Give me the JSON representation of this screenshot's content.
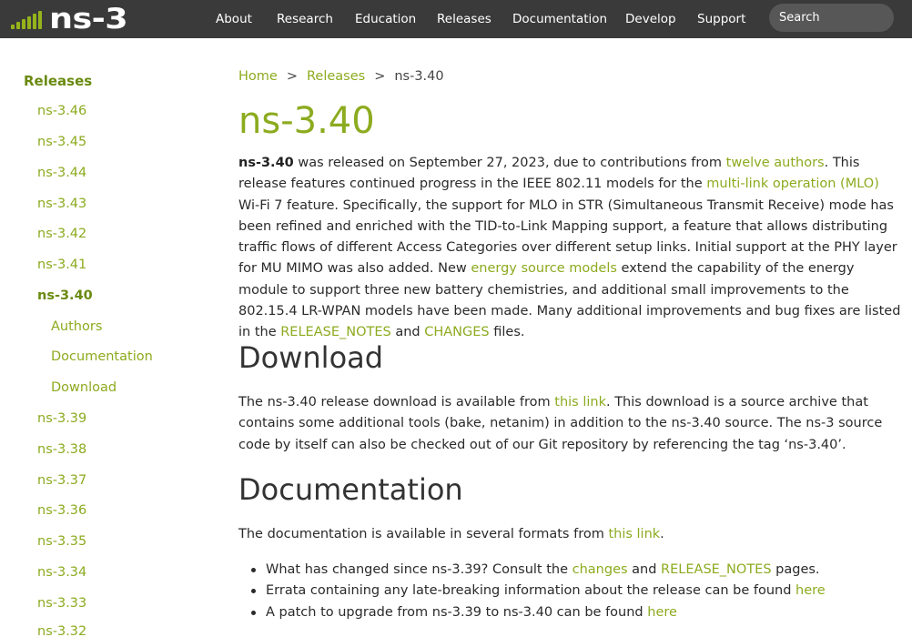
{
  "brand": {
    "logo_text": "ns-3"
  },
  "nav": {
    "items": [
      "About",
      "Research",
      "Education",
      "Releases",
      "Documentation",
      "Develop",
      "Support"
    ],
    "search_placeholder": "Search"
  },
  "sidebar": {
    "heading": "Releases",
    "before": [
      "ns-3.46",
      "ns-3.45",
      "ns-3.44",
      "ns-3.43",
      "ns-3.42",
      "ns-3.41"
    ],
    "active": "ns-3.40",
    "sub": [
      "Authors",
      "Documentation",
      "Download"
    ],
    "after": [
      "ns-3.39",
      "ns-3.38",
      "ns-3.37",
      "ns-3.36",
      "ns-3.35",
      "ns-3.34",
      "ns-3.33",
      "ns-3.32"
    ]
  },
  "breadcrumb": {
    "home": "Home",
    "sep": ">",
    "releases": "Releases",
    "current": "ns-3.40"
  },
  "title": "ns-3.40",
  "intro": {
    "strong": "ns-3.40",
    "t1": " was released on September 27, 2023, due to contributions from ",
    "link_authors": "twelve authors",
    "t2": ". This release features continued progress in the IEEE 802.11 models for the ",
    "link_mlo": "multi-link operation (MLO)",
    "t3": " Wi-Fi 7 feature. Specifically, the support for MLO in STR (Simultaneous Transmit Receive) mode has been refined and enriched with the TID-to-Link Mapping support, a feature that allows distributing traffic flows of different Access Categories over different setup links. Initial support at the PHY layer for MU MIMO was also added. New ",
    "link_energy": "energy source models",
    "t4": " extend the capability of the energy module to support three new battery chemistries, and additional small improvements to the 802.15.4 LR-WPAN models have been made. Many additional improvements and bug fixes are listed in the ",
    "link_release_notes": "RELEASE_NOTES",
    "t5": " and ",
    "link_changes": "CHANGES",
    "t6": " files."
  },
  "download": {
    "heading": "Download",
    "t1": "The ns-3.40 release download is available from ",
    "link": "this link",
    "t2": ". This download is a source archive that contains some additional tools (bake, netanim) in addition to the ns-3.40 source. The ns-3 source code by itself can also be checked out of our Git repository by referencing the tag ‘ns-3.40’."
  },
  "documentation": {
    "heading": "Documentation",
    "t1": "The documentation is available in several formats from ",
    "link": "this link",
    "t2": ".",
    "bullets": [
      {
        "a": "What has changed since ns-3.39? Consult the ",
        "l1": "changes",
        "b": " and ",
        "l2": "RELEASE_NOTES",
        "c": " pages."
      },
      {
        "a": "Errata containing any late-breaking information about the release can be found ",
        "l1": "here"
      },
      {
        "a": "A patch to upgrade from ns-3.39 to ns-3.40 can be found ",
        "l1": "here"
      }
    ]
  },
  "colors": {
    "accent": "#8cab1f",
    "accent_dark": "#6a8a10",
    "topbar": "#3a3a3a",
    "search_bg": "#575757",
    "annotation": "#e41f27"
  }
}
